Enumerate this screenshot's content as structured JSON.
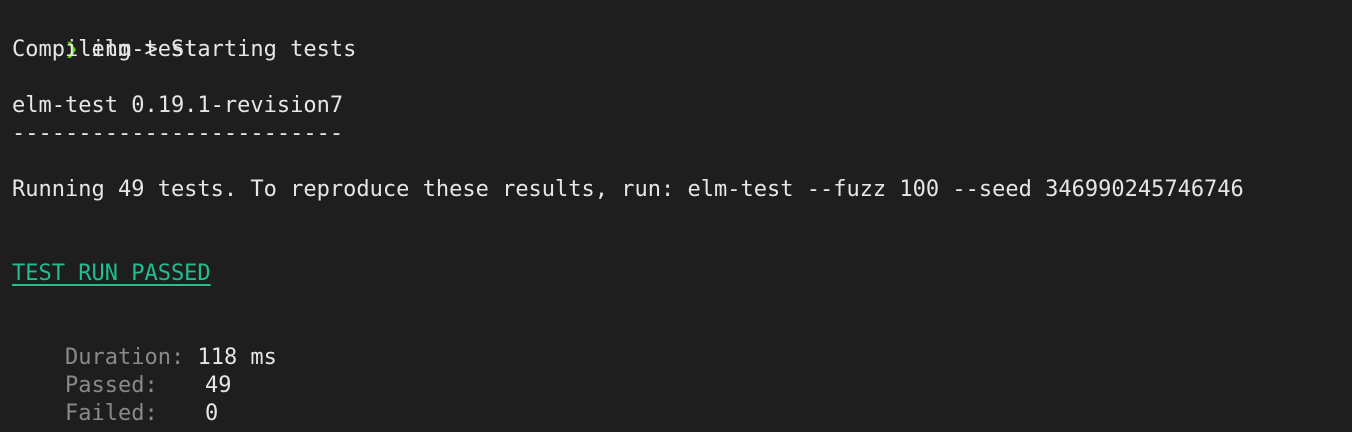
{
  "prompt": {
    "arrow": "❯",
    "command": "elm-test"
  },
  "compile_line": "Compiling > Starting tests",
  "version_line": "elm-test 0.19.1-revision7",
  "divider": "-------------------------",
  "running_line": "Running 49 tests. To reproduce these results, run: elm-test --fuzz 100 --seed 346990245746746",
  "result": "TEST RUN PASSED",
  "stats": {
    "duration_label": "Duration:",
    "duration_value": "118 ms",
    "passed_label": "Passed:",
    "passed_value": "49",
    "failed_label": "Failed:",
    "failed_value": "0"
  },
  "colors": {
    "background": "#1e1e1e",
    "prompt_arrow": "#5fd700",
    "passed": "#1fbf8f",
    "label": "#8a8a8a",
    "text": "#e6e6e6"
  }
}
